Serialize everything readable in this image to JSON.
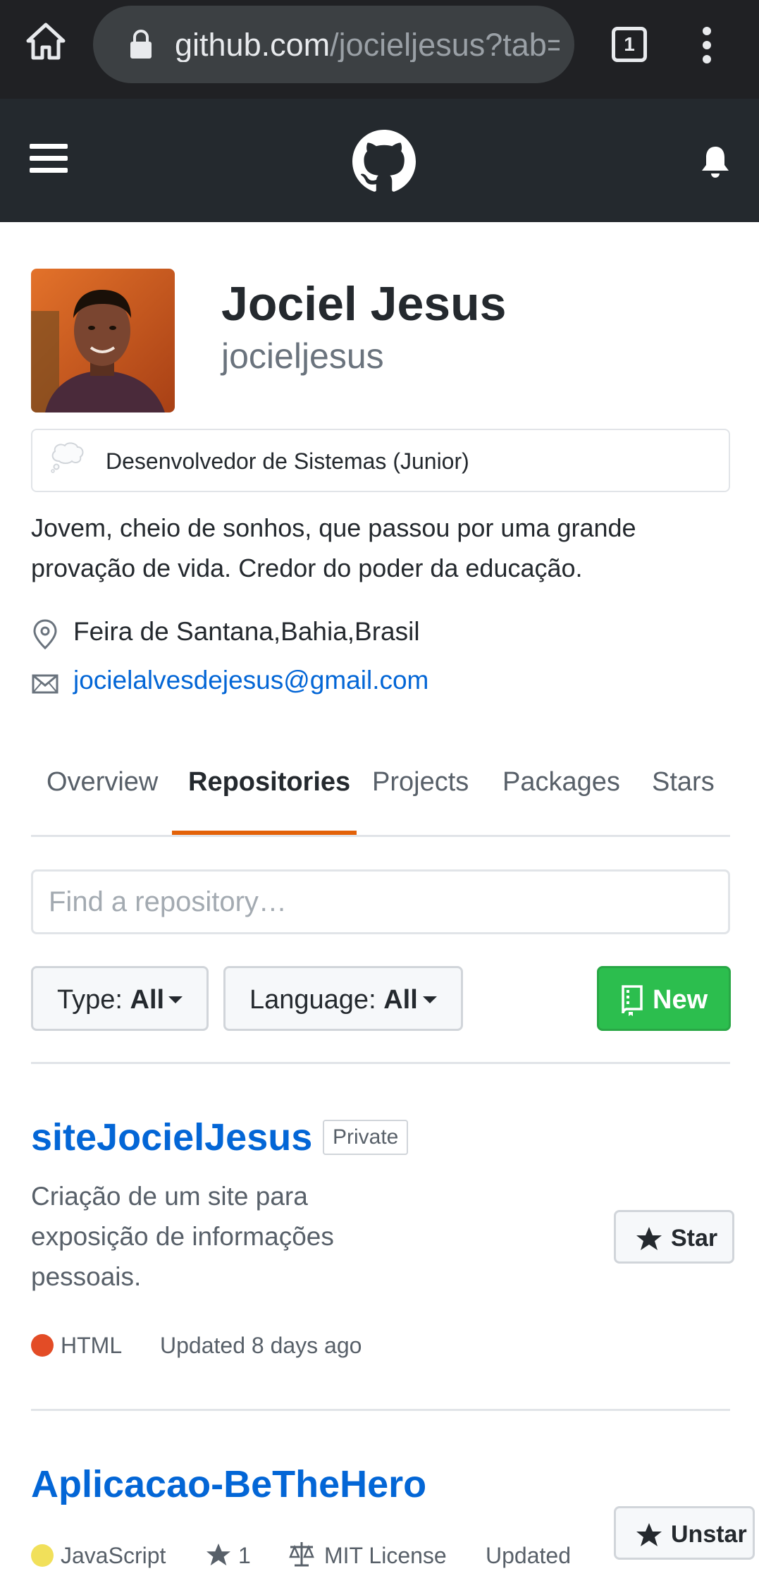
{
  "browser": {
    "url_host": "github.com",
    "url_path": "/jocieljesus?tab=repositories",
    "tab_count": "1",
    "icons": [
      "home-icon",
      "lock-icon",
      "tab-switcher-icon",
      "more-vert-icon"
    ],
    "colors": {
      "toolbar": "#202124",
      "urlbar": "#3c4043"
    }
  },
  "header": {
    "icons": [
      "hamburger-menu-icon",
      "github-octocat-icon",
      "bell-icon"
    ],
    "background": "#24292e"
  },
  "profile": {
    "name": "Jociel Jesus",
    "login": "jocieljesus",
    "status": "Desenvolvedor de Sistemas (Junior)",
    "bio": "Jovem, cheio de sonhos, que passou por uma grande provação de vida. Credor do poder da educação.",
    "location": "Feira de Santana,Bahia,Brasil",
    "email": "jocielalvesdejesus@gmail.com"
  },
  "tabs": [
    {
      "label": "Overview",
      "active": false
    },
    {
      "label": "Repositories",
      "active": true
    },
    {
      "label": "Projects",
      "active": false
    },
    {
      "label": "Packages",
      "active": false
    },
    {
      "label": "Stars",
      "active": false
    }
  ],
  "filters": {
    "search_placeholder": "Find a repository…",
    "type_label": "Type:",
    "type_value": "All",
    "language_label": "Language:",
    "language_value": "All",
    "new_label": "New"
  },
  "repos": [
    {
      "name": "siteJocielJesus",
      "badge": "Private",
      "description": "Criação de um site para exposição de informações pessoais.",
      "language": "HTML",
      "language_color": "#e34c26",
      "updated": "Updated 8 days ago",
      "star_button": "Star"
    },
    {
      "name": "Aplicacao-BeTheHero",
      "language": "JavaScript",
      "language_color": "#f1e05a",
      "stars": "1",
      "license": "MIT License",
      "updated": "Updated",
      "star_button": "Unstar"
    }
  ],
  "colors": {
    "link": "#0366d6",
    "active_tab_underline": "#e36209",
    "new_button": "#2cbe4e"
  }
}
